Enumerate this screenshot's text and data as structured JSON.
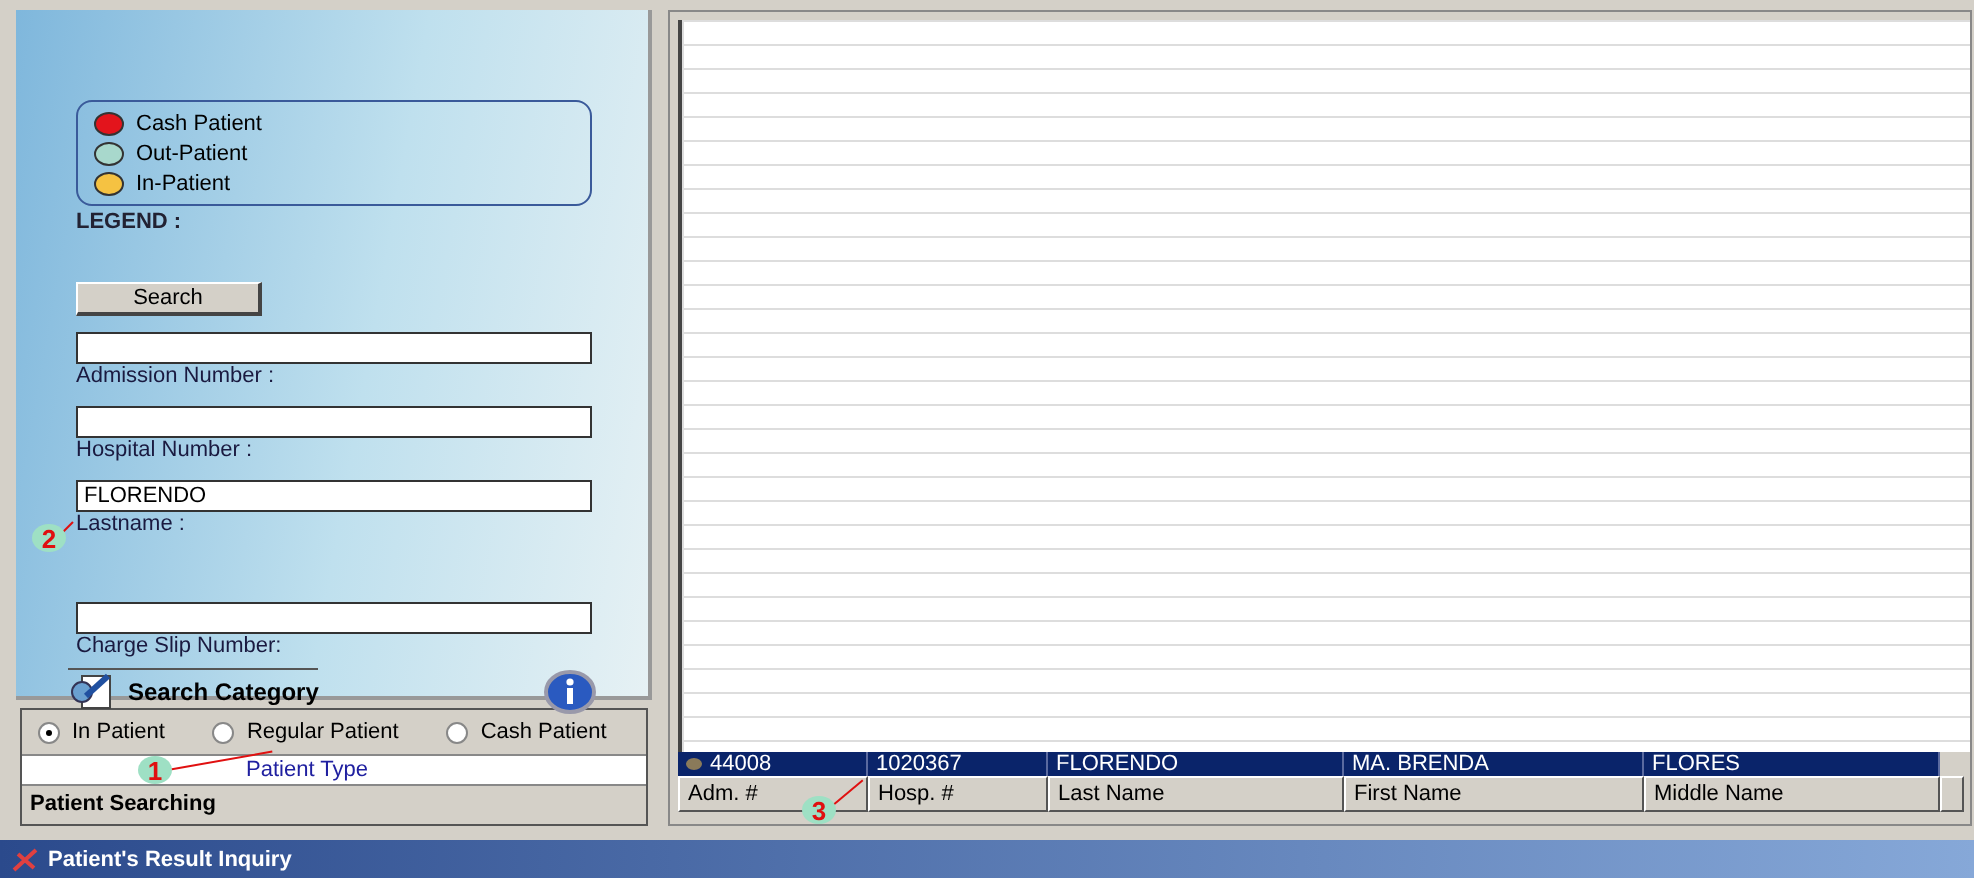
{
  "search_panel": {
    "legend": [
      {
        "label": "Cash Patient",
        "color": "#e3141c"
      },
      {
        "label": "Out-Patient",
        "color": "#a8d8cc"
      },
      {
        "label": "In-Patient",
        "color": "#f5c242"
      }
    ],
    "legend_title": "LEGEND :",
    "search_button": "Search",
    "fields": [
      {
        "label": "Admission Number :"
      },
      {
        "label": "Hospital Number :"
      },
      {
        "label": "Lastname :",
        "value": "FLORENDO",
        "callout": "2"
      },
      {
        "label": "Charge Slip Number:"
      }
    ],
    "category": "Search Category"
  },
  "patient_searching": {
    "radios": [
      {
        "label": "In Patient",
        "selected": true
      },
      {
        "label": "Regular Patient",
        "selected": false
      },
      {
        "label": "Cash Patient",
        "selected": false
      }
    ],
    "tab": "Patient Type",
    "callout": "1",
    "title": "Patient Searching"
  },
  "table": {
    "rows": [
      {
        "selected": true,
        "cells": [
          "44008",
          "1020367",
          "FLORENDO",
          "MA. BRENDA",
          "FLORES"
        ]
      }
    ],
    "bottom_header_bar": [
      "Adm. #",
      "Hosp. #",
      "Last Name",
      "First Name",
      "Middle Name"
    ],
    "callout": "3"
  },
  "window": {
    "title": "Patient's Result Inquiry"
  }
}
